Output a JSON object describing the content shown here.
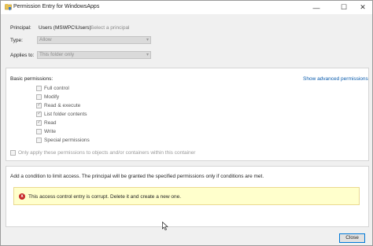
{
  "window": {
    "title": "Permission Entry for WindowsApps",
    "minimize_glyph": "—",
    "maximize_glyph": "☐",
    "close_glyph": "✕"
  },
  "header": {
    "principal_label": "Principal:",
    "principal_value": "Users (MSWPC\\Users)",
    "select_principal": "Select a principal",
    "type_label": "Type:",
    "type_value": "Allow",
    "applies_label": "Applies to:",
    "applies_value": "This folder only"
  },
  "permissions": {
    "heading": "Basic permissions:",
    "advanced_link": "Show advanced permissions",
    "items": [
      {
        "label": "Full control",
        "checked": false
      },
      {
        "label": "Modify",
        "checked": false
      },
      {
        "label": "Read & execute",
        "checked": true
      },
      {
        "label": "List folder contents",
        "checked": true
      },
      {
        "label": "Read",
        "checked": true
      },
      {
        "label": "Write",
        "checked": false
      },
      {
        "label": "Special permissions",
        "checked": false
      }
    ],
    "apply_only": "Only apply these permissions to objects and/or containers within this container"
  },
  "conditions": {
    "text": "Add a condition to limit access. The principal will be granted the specified permissions only if conditions are met.",
    "warning": "This access control entry is corrupt. Delete it and create a new one.",
    "warning_icon": "x"
  },
  "footer": {
    "close_label": "Close"
  },
  "icons": {
    "app": "folder-shield-icon",
    "combo": "chevron-down-icon",
    "warning": "error-icon",
    "cursor": "mouse-pointer-icon"
  },
  "colors": {
    "link": "#0b5cad",
    "warning_bg": "#ffffcc",
    "error": "#c62828",
    "focus_border": "#0078d7"
  }
}
